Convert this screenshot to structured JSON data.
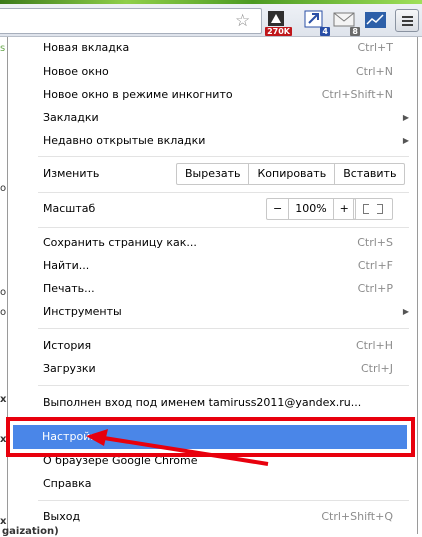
{
  "toolbar": {
    "extensions": [
      {
        "name": "extension-icon-1",
        "badge": "270K",
        "badge_color": "#c0171b"
      },
      {
        "name": "extension-icon-2",
        "badge": "4",
        "badge_color": "#2a4fa6"
      },
      {
        "name": "mail-extension-icon",
        "badge": "8",
        "badge_color": "#6b6b6b"
      },
      {
        "name": "chart-extension-icon",
        "badge": "",
        "badge_color": ""
      }
    ]
  },
  "menu": {
    "new_tab": {
      "label": "Новая вкладка",
      "shortcut": "Ctrl+T"
    },
    "new_window": {
      "label": "Новое окно",
      "shortcut": "Ctrl+N"
    },
    "incognito": {
      "label": "Новое окно в режиме инкогнито",
      "shortcut": "Ctrl+Shift+N"
    },
    "bookmarks": {
      "label": "Закладки"
    },
    "recent_tabs": {
      "label": "Недавно открытые вкладки"
    },
    "edit": {
      "label": "Изменить",
      "cut": "Вырезать",
      "copy": "Копировать",
      "paste": "Вставить"
    },
    "zoom": {
      "label": "Масштаб",
      "minus": "−",
      "value": "100%",
      "plus": "+"
    },
    "save_page": {
      "label": "Сохранить страницу как...",
      "shortcut": "Ctrl+S"
    },
    "find": {
      "label": "Найти...",
      "shortcut": "Ctrl+F"
    },
    "print": {
      "label": "Печать...",
      "shortcut": "Ctrl+P"
    },
    "tools": {
      "label": "Инструменты"
    },
    "history": {
      "label": "История",
      "shortcut": "Ctrl+H"
    },
    "downloads": {
      "label": "Загрузки",
      "shortcut": "Ctrl+J"
    },
    "signed_in": {
      "label": "Выполнен вход под именем tamiruss2011@yandex.ru..."
    },
    "settings": {
      "label": "Настройки"
    },
    "about": {
      "label": "О браузере Google Chrome"
    },
    "help": {
      "label": "Справка"
    },
    "exit": {
      "label": "Выход",
      "shortcut": "Ctrl+Shift+Q"
    }
  },
  "background": {
    "fragments": [
      "s",
      "о",
      "о",
      "о",
      "х",
      "х",
      "х",
      "gaization)"
    ]
  },
  "colors": {
    "highlight": "#4a86e8",
    "annotation": "#e8000d"
  }
}
